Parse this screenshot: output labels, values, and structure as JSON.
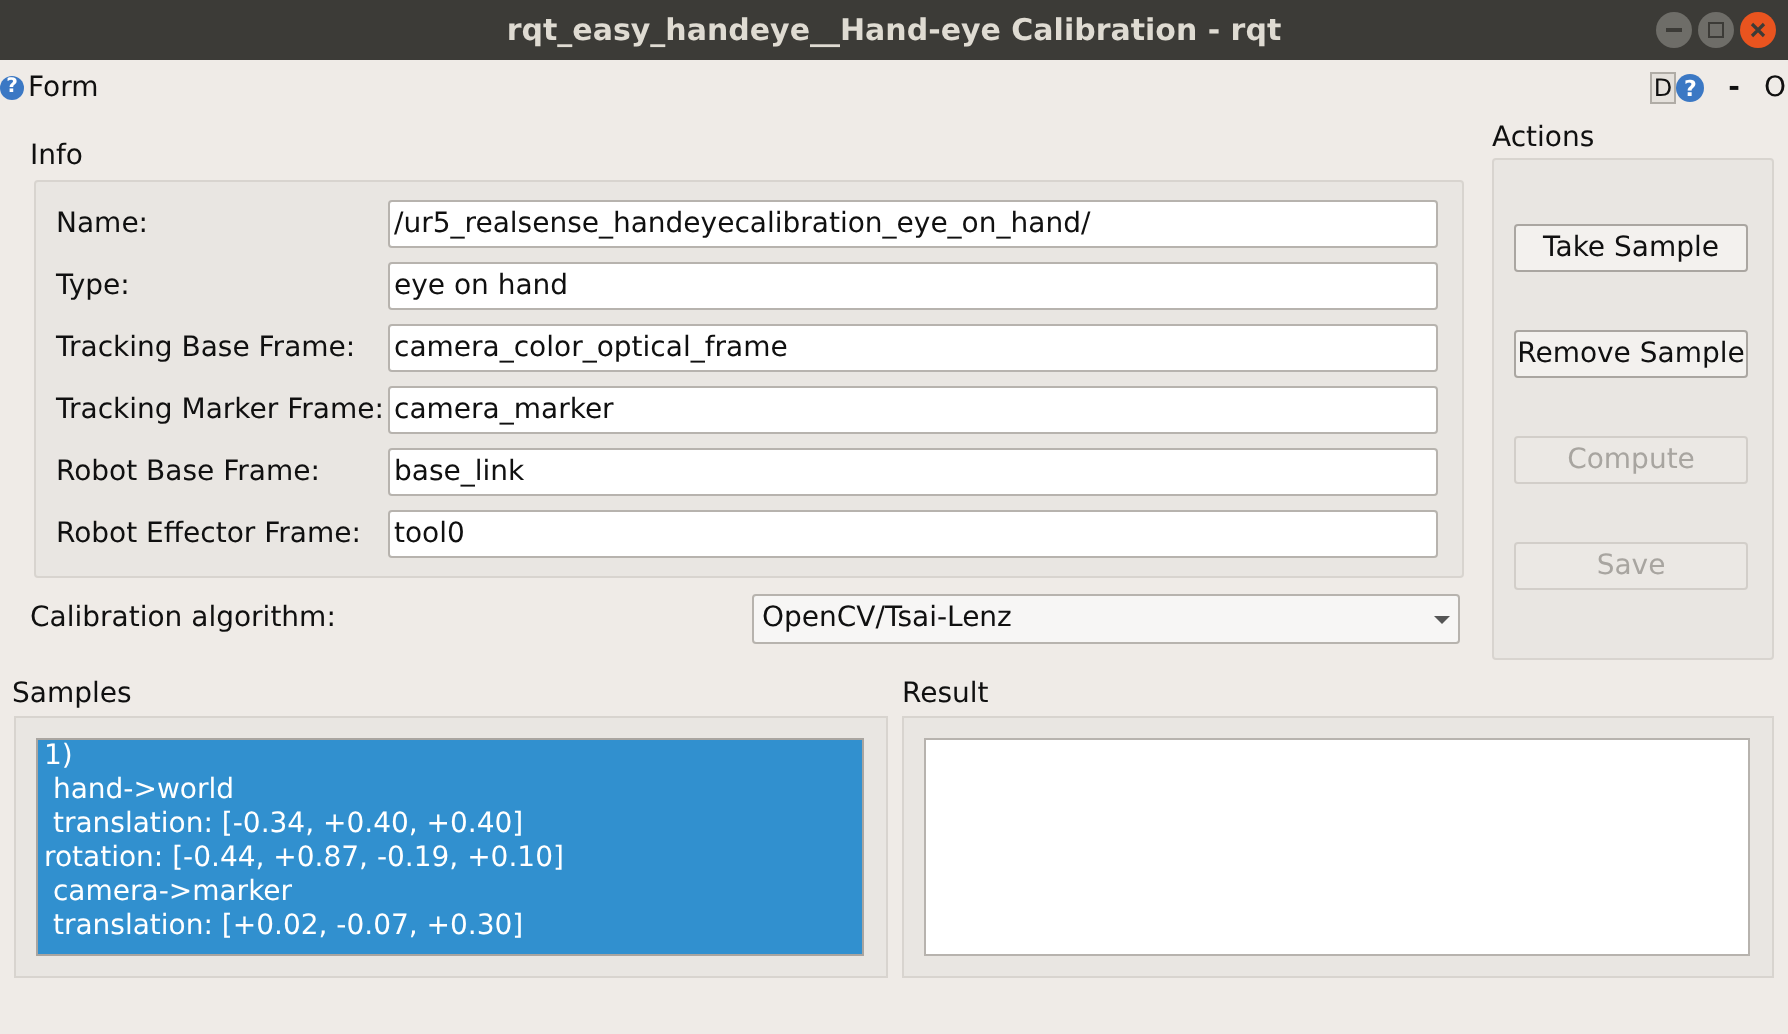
{
  "window": {
    "title": "rqt_easy_handeye__Hand-eye Calibration - rqt"
  },
  "plugin_bar": {
    "help_mark": "?",
    "title": "Form",
    "d_button": "D",
    "help_mark_right": "?",
    "minimize": "-",
    "close": "O"
  },
  "info": {
    "title": "Info",
    "fields": [
      {
        "label": "Name:",
        "value": "/ur5_realsense_handeyecalibration_eye_on_hand/"
      },
      {
        "label": "Type:",
        "value": "eye on hand"
      },
      {
        "label": "Tracking Base Frame:",
        "value": "camera_color_optical_frame"
      },
      {
        "label": "Tracking Marker Frame:",
        "value": "camera_marker"
      },
      {
        "label": "Robot Base Frame:",
        "value": "base_link"
      },
      {
        "label": "Robot Effector Frame:",
        "value": "tool0"
      }
    ]
  },
  "algorithm": {
    "label": "Calibration algorithm:",
    "value": "OpenCV/Tsai-Lenz"
  },
  "actions": {
    "title": "Actions",
    "buttons": [
      {
        "label": "Take Sample",
        "disabled": false
      },
      {
        "label": "Remove Sample",
        "disabled": false
      },
      {
        "label": "Compute",
        "disabled": true
      },
      {
        "label": "Save",
        "disabled": true
      }
    ]
  },
  "samples": {
    "title": "Samples",
    "items": [
      {
        "selected": true,
        "lines": [
          "1)",
          " hand->world",
          " translation: [-0.34, +0.40, +0.40]",
          "rotation: [-0.44, +0.87, -0.19, +0.10]",
          " camera->marker",
          " translation: [+0.02, -0.07, +0.30]"
        ]
      }
    ]
  },
  "result": {
    "title": "Result"
  }
}
